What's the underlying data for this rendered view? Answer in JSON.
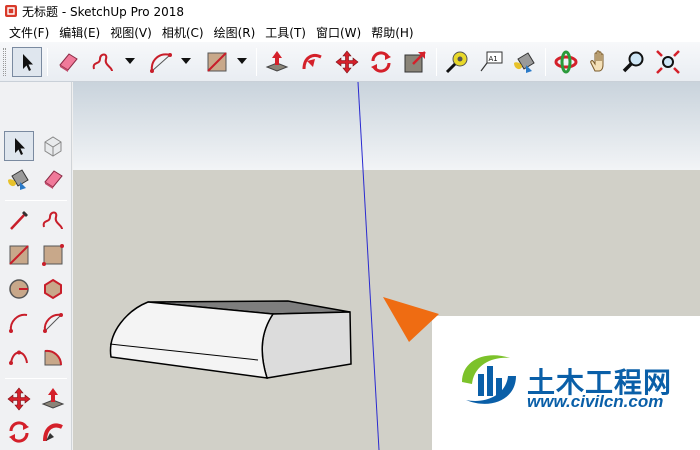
{
  "window": {
    "title": "无标题 - SketchUp Pro 2018"
  },
  "menu": [
    {
      "label": "文件(F)"
    },
    {
      "label": "编辑(E)"
    },
    {
      "label": "视图(V)"
    },
    {
      "label": "相机(C)"
    },
    {
      "label": "绘图(R)"
    },
    {
      "label": "工具(T)"
    },
    {
      "label": "窗口(W)"
    },
    {
      "label": "帮助(H)"
    }
  ],
  "toolbar": {
    "tools": [
      "select-icon",
      "eraser-icon",
      "freehand-icon",
      "arc-icon",
      "rectangle-icon",
      "push-pull-icon",
      "follow-me-icon",
      "move-icon",
      "rotate-icon",
      "scale-icon",
      "tape-measure-icon",
      "text-icon",
      "paint-bucket-icon",
      "orbit-icon",
      "pan-icon",
      "zoom-icon",
      "zoom-extents-icon"
    ],
    "text_tool_label": "A1",
    "selected_tool": "select"
  },
  "left_toolbar": {
    "tools": [
      "select-icon",
      "component-icon",
      "paint-bucket-icon",
      "eraser-icon",
      "line-icon",
      "freehand-icon",
      "rectangle-icon",
      "rotated-rectangle-icon",
      "circle-icon",
      "polygon-icon",
      "arc-icon",
      "two-point-arc-icon",
      "three-point-arc-icon",
      "pie-icon",
      "move-icon",
      "push-pull-icon",
      "rotate-icon",
      "follow-me-icon"
    ]
  },
  "colors": {
    "sky": "#c9d3dc",
    "ground": "#d1d0c8",
    "axis_blue": "#2a2ad0",
    "watermark_orange": "#ef6c12",
    "watermark_blue": "#0a5fa8"
  },
  "watermark": {
    "name": "土木工程网",
    "url": "www.civilcn.com"
  }
}
